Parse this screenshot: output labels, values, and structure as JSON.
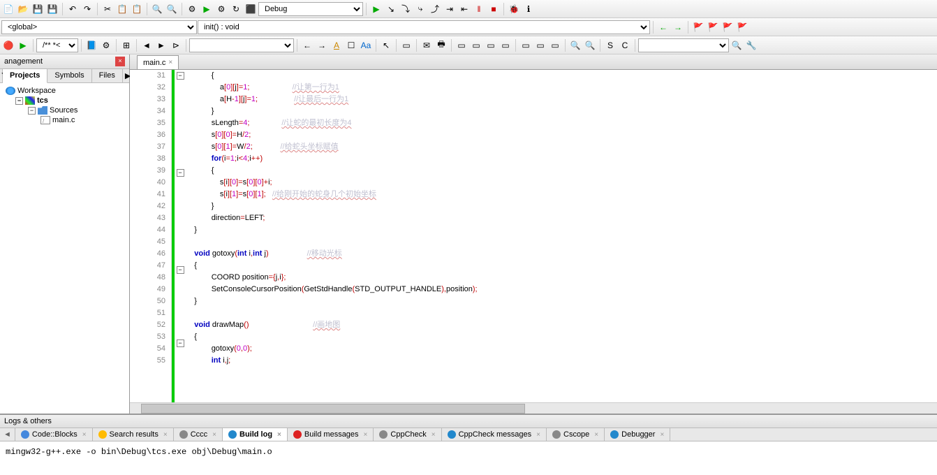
{
  "toolbar1": {
    "debug_combo": "Debug"
  },
  "toolbar2": {
    "scope_combo": "<global>",
    "func_combo": "init() : void"
  },
  "toolbar3": {
    "comment_combo": "/** *<  ..."
  },
  "management": {
    "title": "anagement",
    "tabs": [
      "Projects",
      "Symbols",
      "Files"
    ],
    "active_tab": 0,
    "tree": {
      "workspace": "Workspace",
      "project": "tcs",
      "folder": "Sources",
      "file": "main.c"
    }
  },
  "editor": {
    "tab_name": "main.c",
    "first_line": 31,
    "lines": [
      {
        "n": 31,
        "fold": "-",
        "indent": 3,
        "tokens": [
          {
            "t": "{",
            "c": "br"
          }
        ]
      },
      {
        "n": 32,
        "indent": 4,
        "tokens": [
          {
            "t": "a",
            "c": ""
          },
          {
            "t": "[",
            "c": "op"
          },
          {
            "t": "0",
            "c": "num"
          },
          {
            "t": "][",
            "c": "op"
          },
          {
            "t": "j",
            "c": ""
          },
          {
            "t": "]=",
            "c": "op"
          },
          {
            "t": "1",
            "c": "num"
          },
          {
            "t": ";",
            "c": "op"
          }
        ],
        "cmt": "//让第一行为1",
        "cmtcol": 20
      },
      {
        "n": 33,
        "indent": 4,
        "tokens": [
          {
            "t": "a",
            "c": ""
          },
          {
            "t": "[",
            "c": "op"
          },
          {
            "t": "H",
            "c": ""
          },
          {
            "t": "-",
            "c": "op"
          },
          {
            "t": "1",
            "c": "num"
          },
          {
            "t": "][",
            "c": "op"
          },
          {
            "t": "j",
            "c": ""
          },
          {
            "t": "]=",
            "c": "op"
          },
          {
            "t": "1",
            "c": "num"
          },
          {
            "t": ";",
            "c": "op"
          }
        ],
        "cmt": "//让最后一行为1",
        "cmtcol": 17
      },
      {
        "n": 34,
        "indent": 3,
        "tokens": [
          {
            "t": "}",
            "c": "br"
          }
        ]
      },
      {
        "n": 35,
        "indent": 3,
        "tokens": [
          {
            "t": "sLength",
            "c": ""
          },
          {
            "t": "=",
            "c": "op"
          },
          {
            "t": "4",
            "c": "num"
          },
          {
            "t": ";",
            "c": "op"
          }
        ],
        "cmt": "//让蛇的最初长度为4",
        "cmtcol": 15
      },
      {
        "n": 36,
        "indent": 3,
        "tokens": [
          {
            "t": "s",
            "c": ""
          },
          {
            "t": "[",
            "c": "op"
          },
          {
            "t": "0",
            "c": "num"
          },
          {
            "t": "][",
            "c": "op"
          },
          {
            "t": "0",
            "c": "num"
          },
          {
            "t": "]=",
            "c": "op"
          },
          {
            "t": "H",
            "c": ""
          },
          {
            "t": "/",
            "c": "op"
          },
          {
            "t": "2",
            "c": "num"
          },
          {
            "t": ";",
            "c": "op"
          }
        ]
      },
      {
        "n": 37,
        "indent": 3,
        "tokens": [
          {
            "t": "s",
            "c": ""
          },
          {
            "t": "[",
            "c": "op"
          },
          {
            "t": "0",
            "c": "num"
          },
          {
            "t": "][",
            "c": "op"
          },
          {
            "t": "1",
            "c": "num"
          },
          {
            "t": "]=",
            "c": "op"
          },
          {
            "t": "W",
            "c": ""
          },
          {
            "t": "/",
            "c": "op"
          },
          {
            "t": "2",
            "c": "num"
          },
          {
            "t": ";",
            "c": "op"
          }
        ],
        "cmt": "//给蛇头坐标赋值",
        "cmtcol": 13
      },
      {
        "n": 38,
        "indent": 3,
        "tokens": [
          {
            "t": "for",
            "c": "kw"
          },
          {
            "t": "(",
            "c": "op"
          },
          {
            "t": "i",
            "c": ""
          },
          {
            "t": "=",
            "c": "op"
          },
          {
            "t": "1",
            "c": "num"
          },
          {
            "t": ";",
            "c": "op"
          },
          {
            "t": "i",
            "c": ""
          },
          {
            "t": "<",
            "c": "op"
          },
          {
            "t": "4",
            "c": "num"
          },
          {
            "t": ";",
            "c": "op"
          },
          {
            "t": "i",
            "c": ""
          },
          {
            "t": "++)",
            "c": "op"
          }
        ]
      },
      {
        "n": 39,
        "fold": "-",
        "indent": 3,
        "tokens": [
          {
            "t": "{",
            "c": "br"
          }
        ]
      },
      {
        "n": 40,
        "indent": 4,
        "tokens": [
          {
            "t": "s",
            "c": ""
          },
          {
            "t": "[",
            "c": "op"
          },
          {
            "t": "i",
            "c": ""
          },
          {
            "t": "][",
            "c": "op"
          },
          {
            "t": "0",
            "c": "num"
          },
          {
            "t": "]=",
            "c": "op"
          },
          {
            "t": "s",
            "c": ""
          },
          {
            "t": "[",
            "c": "op"
          },
          {
            "t": "0",
            "c": "num"
          },
          {
            "t": "][",
            "c": "op"
          },
          {
            "t": "0",
            "c": "num"
          },
          {
            "t": "]+",
            "c": "op"
          },
          {
            "t": "i",
            "c": ""
          },
          {
            "t": ";",
            "c": "op"
          }
        ]
      },
      {
        "n": 41,
        "indent": 4,
        "tokens": [
          {
            "t": "s",
            "c": ""
          },
          {
            "t": "[",
            "c": "op"
          },
          {
            "t": "i",
            "c": ""
          },
          {
            "t": "][",
            "c": "op"
          },
          {
            "t": "1",
            "c": "num"
          },
          {
            "t": "]=",
            "c": "op"
          },
          {
            "t": "s",
            "c": ""
          },
          {
            "t": "[",
            "c": "op"
          },
          {
            "t": "0",
            "c": "num"
          },
          {
            "t": "][",
            "c": "op"
          },
          {
            "t": "1",
            "c": "num"
          },
          {
            "t": "];",
            "c": "op"
          }
        ],
        "cmt": "//给刚开始的蛇身几个初始坐标",
        "cmtcol": 3
      },
      {
        "n": 42,
        "indent": 3,
        "tokens": [
          {
            "t": "}",
            "c": "br"
          }
        ]
      },
      {
        "n": 43,
        "indent": 3,
        "tokens": [
          {
            "t": "direction",
            "c": ""
          },
          {
            "t": "=",
            "c": "op"
          },
          {
            "t": "LEFT",
            "c": ""
          },
          {
            "t": ";",
            "c": "op"
          }
        ]
      },
      {
        "n": 44,
        "indent": 1,
        "tokens": [
          {
            "t": "}",
            "c": "br"
          }
        ]
      },
      {
        "n": 45,
        "indent": 0,
        "tokens": []
      },
      {
        "n": 46,
        "indent": 1,
        "tokens": [
          {
            "t": "void",
            "c": "kw"
          },
          {
            "t": " gotoxy",
            "c": ""
          },
          {
            "t": "(",
            "c": "op"
          },
          {
            "t": "int",
            "c": "kw"
          },
          {
            "t": " i",
            "c": ""
          },
          {
            "t": ",",
            "c": "op"
          },
          {
            "t": "int",
            "c": "kw"
          },
          {
            "t": " j",
            "c": ""
          },
          {
            "t": ")",
            "c": "op"
          }
        ],
        "cmt": "//移动光标",
        "cmtcol": 18
      },
      {
        "n": 47,
        "fold": "-",
        "indent": 1,
        "tokens": [
          {
            "t": "{",
            "c": "br"
          }
        ]
      },
      {
        "n": 48,
        "indent": 3,
        "tokens": [
          {
            "t": "COORD position",
            "c": ""
          },
          {
            "t": "={",
            "c": "op"
          },
          {
            "t": "j",
            "c": ""
          },
          {
            "t": ",",
            "c": "op"
          },
          {
            "t": "i",
            "c": ""
          },
          {
            "t": "};",
            "c": "op"
          }
        ]
      },
      {
        "n": 49,
        "indent": 3,
        "tokens": [
          {
            "t": "SetConsoleCursorPosition",
            "c": ""
          },
          {
            "t": "(",
            "c": "op"
          },
          {
            "t": "GetStdHandle",
            "c": ""
          },
          {
            "t": "(",
            "c": "op"
          },
          {
            "t": "STD_OUTPUT_HANDLE",
            "c": ""
          },
          {
            "t": "),",
            "c": "op"
          },
          {
            "t": "position",
            "c": ""
          },
          {
            "t": ");",
            "c": "op"
          }
        ]
      },
      {
        "n": 50,
        "indent": 1,
        "tokens": [
          {
            "t": "}",
            "c": "br"
          }
        ]
      },
      {
        "n": 51,
        "indent": 0,
        "tokens": []
      },
      {
        "n": 52,
        "indent": 1,
        "tokens": [
          {
            "t": "void",
            "c": "kw"
          },
          {
            "t": " drawMap",
            "c": ""
          },
          {
            "t": "()",
            "c": "op"
          }
        ],
        "cmt": "//画地图",
        "cmtcol": 30
      },
      {
        "n": 53,
        "fold": "-",
        "indent": 1,
        "tokens": [
          {
            "t": "{",
            "c": "br"
          }
        ]
      },
      {
        "n": 54,
        "indent": 3,
        "tokens": [
          {
            "t": "gotoxy",
            "c": ""
          },
          {
            "t": "(",
            "c": "op"
          },
          {
            "t": "0",
            "c": "num"
          },
          {
            "t": ",",
            "c": "op"
          },
          {
            "t": "0",
            "c": "num"
          },
          {
            "t": ");",
            "c": "op"
          }
        ]
      },
      {
        "n": 55,
        "indent": 3,
        "tokens": [
          {
            "t": "int",
            "c": "kw"
          },
          {
            "t": " i",
            "c": ""
          },
          {
            "t": ",",
            "c": "op"
          },
          {
            "t": "j",
            "c": ""
          },
          {
            "t": ";",
            "c": "op"
          }
        ]
      }
    ]
  },
  "logs": {
    "header": "Logs & others",
    "tabs": [
      {
        "label": "Code::Blocks",
        "ico": "#48d"
      },
      {
        "label": "Search results",
        "ico": "#fb0"
      },
      {
        "label": "Cccc",
        "ico": "#888"
      },
      {
        "label": "Build log",
        "ico": "#28c",
        "active": true
      },
      {
        "label": "Build messages",
        "ico": "#d22"
      },
      {
        "label": "CppCheck",
        "ico": "#888"
      },
      {
        "label": "CppCheck messages",
        "ico": "#28c"
      },
      {
        "label": "Cscope",
        "ico": "#888"
      },
      {
        "label": "Debugger",
        "ico": "#28c"
      }
    ],
    "content": "mingw32-g++.exe  -o bin\\Debug\\tcs.exe obj\\Debug\\main.o"
  }
}
